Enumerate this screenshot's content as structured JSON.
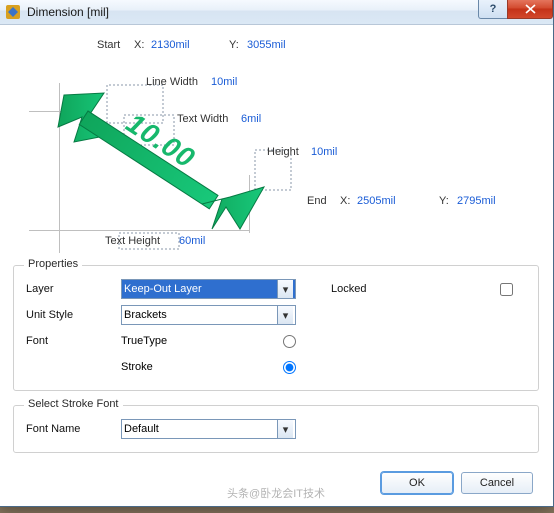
{
  "window": {
    "title": "Dimension [mil]"
  },
  "diagram": {
    "start_label": "Start",
    "start_x_label": "X:",
    "start_x": "2130mil",
    "start_y_label": "Y:",
    "start_y": "3055mil",
    "line_width_label": "Line Width",
    "line_width": "10mil",
    "text_width_label": "Text Width",
    "text_width": "6mil",
    "height_label": "Height",
    "height": "10mil",
    "end_label": "End",
    "end_x_label": "X:",
    "end_x": "2505mil",
    "end_y_label": "Y:",
    "end_y": "2795mil",
    "text_height_label": "Text Height",
    "text_height": "60mil",
    "big_value": "10.00"
  },
  "properties": {
    "legend": "Properties",
    "layer_label": "Layer",
    "layer_value": "Keep-Out Layer",
    "locked_label": "Locked",
    "unit_style_label": "Unit Style",
    "unit_style_value": "Brackets",
    "font_label": "Font",
    "truetype_label": "TrueType",
    "stroke_label": "Stroke"
  },
  "stroke_font": {
    "legend": "Select Stroke Font",
    "font_name_label": "Font Name",
    "font_name_value": "Default"
  },
  "buttons": {
    "ok": "OK",
    "cancel": "Cancel"
  },
  "watermark": "头条@卧龙会IT技术"
}
